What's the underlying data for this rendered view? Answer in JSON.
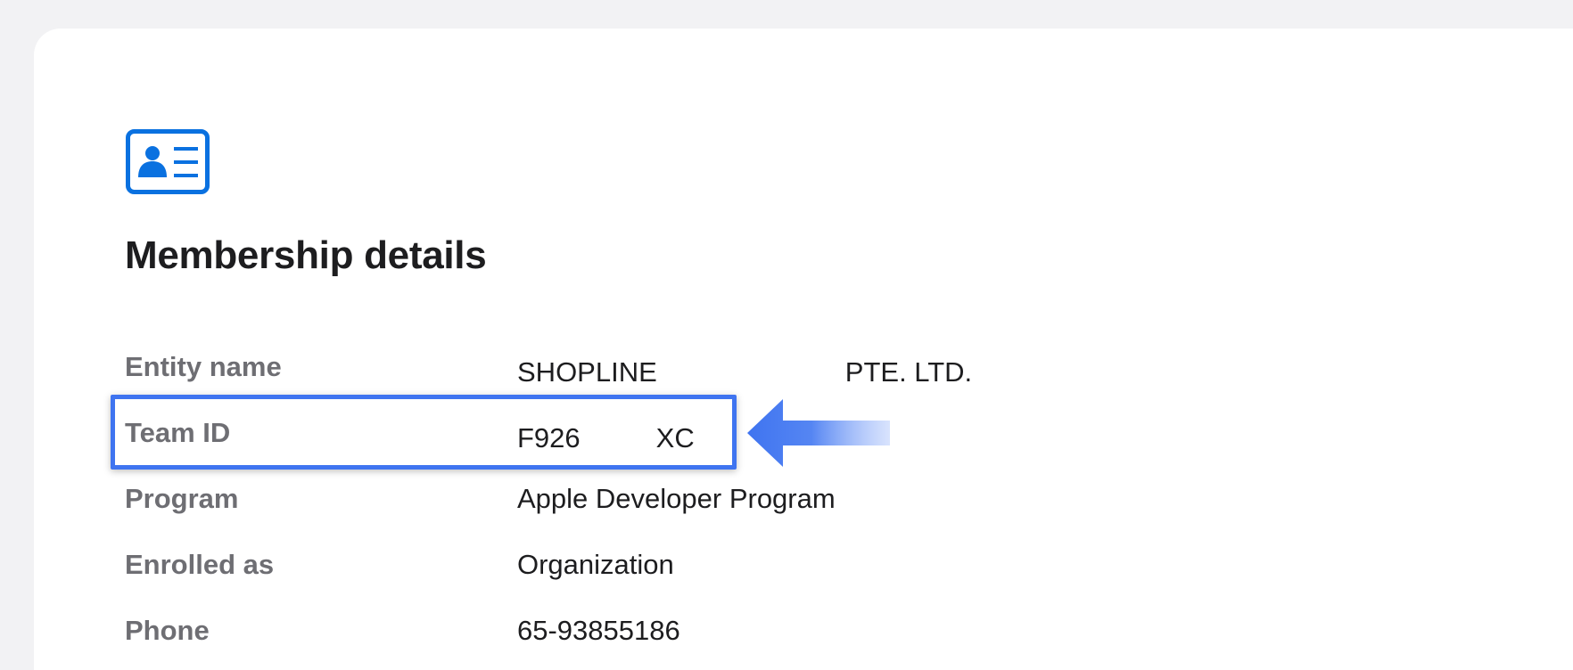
{
  "section": {
    "icon": "id-card-icon",
    "title": "Membership details"
  },
  "details": {
    "entity_name": {
      "label": "Entity name",
      "value_start": "SHOPLINE",
      "value_end": "PTE. LTD."
    },
    "team_id": {
      "label": "Team ID",
      "value_start": "F926",
      "value_end": "XC"
    },
    "program": {
      "label": "Program",
      "value": "Apple Developer Program"
    },
    "enrolled_as": {
      "label": "Enrolled as",
      "value": "Organization"
    },
    "phone": {
      "label": "Phone",
      "value": "65-93855186"
    }
  },
  "annotation": {
    "highlight_color": "#3f74f0",
    "arrow_icon": "left-arrow-icon"
  },
  "colors": {
    "page_background": "#f2f2f4",
    "card_background": "#ffffff",
    "icon_blue": "#0a71e0",
    "label_gray": "#6e6e73",
    "text_dark": "#1d1d1f"
  }
}
